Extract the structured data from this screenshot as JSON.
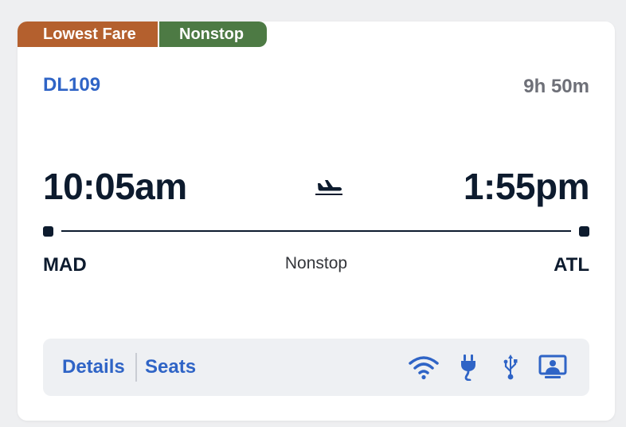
{
  "badges": {
    "fare": "Lowest Fare",
    "nonstop": "Nonstop"
  },
  "flight": {
    "number": "DL109",
    "duration": "9h 50m",
    "departure_time": "10:05am",
    "arrival_time": "1:55pm",
    "origin": "MAD",
    "destination": "ATL",
    "stops": "Nonstop"
  },
  "footer": {
    "details_label": "Details",
    "seats_label": "Seats",
    "amenities": [
      "wifi-icon",
      "power-outlet-icon",
      "usb-icon",
      "personal-screen-icon"
    ]
  },
  "colors": {
    "fare_badge": "#b4602e",
    "nonstop_badge": "#4d7a44",
    "link_blue": "#2f64c6",
    "navy_text": "#0d1b2e"
  }
}
